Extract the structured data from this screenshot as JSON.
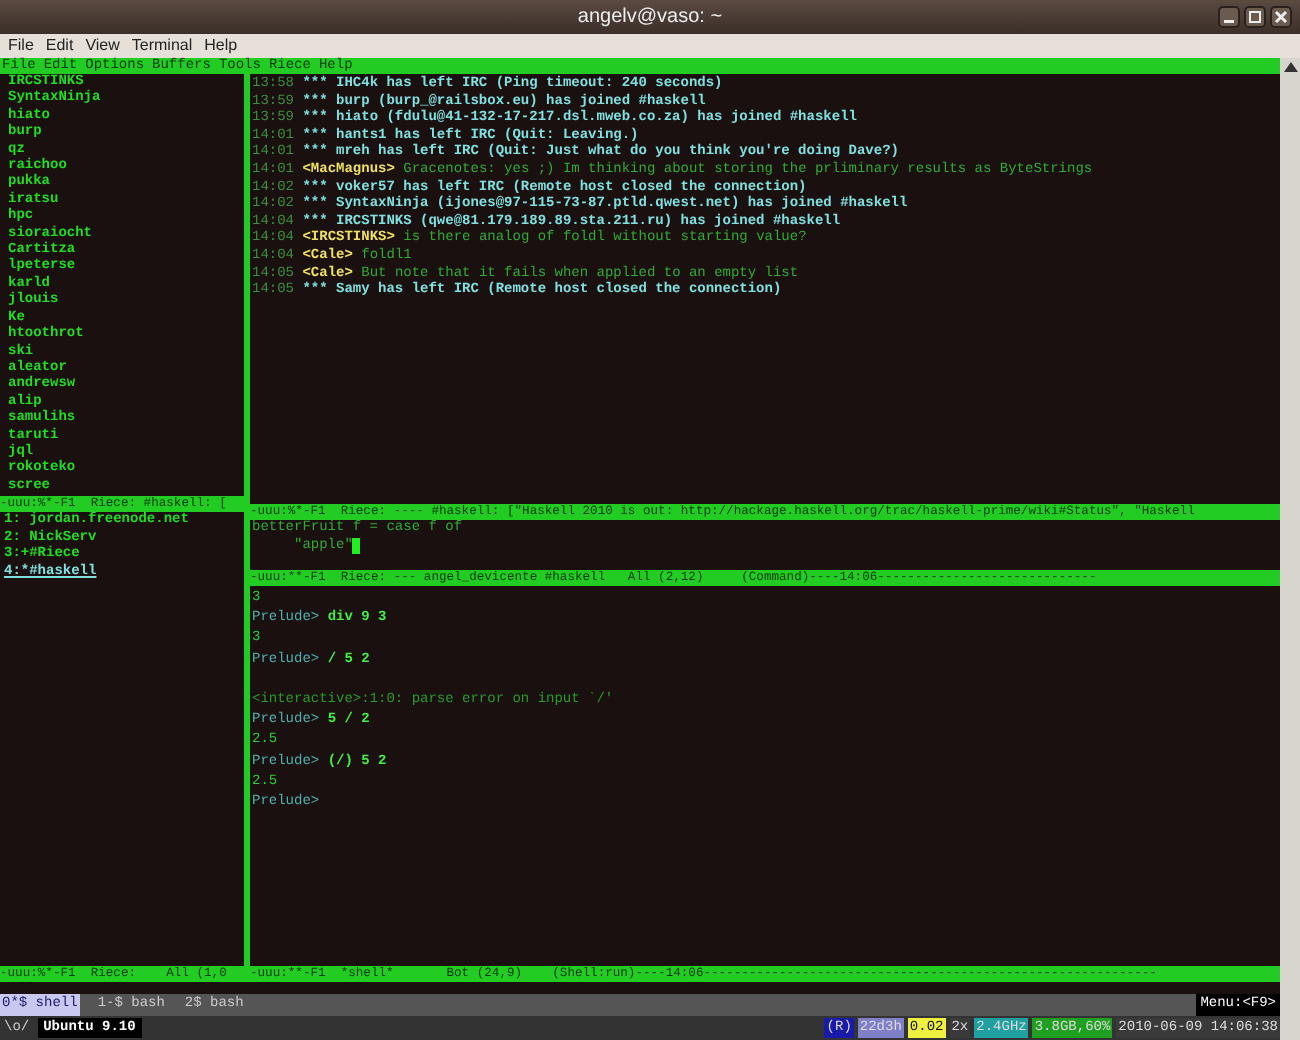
{
  "window": {
    "title": "angelv@vaso: ~"
  },
  "app_menu": [
    "File",
    "Edit",
    "View",
    "Terminal",
    "Help"
  ],
  "emacs_menu": [
    "File",
    "Edit",
    "Options",
    "Buffers",
    "Tools",
    "Riece",
    "Help"
  ],
  "nick_list": [
    "IRCSTINKS",
    "SyntaxNinja",
    "hiato",
    "burp",
    "qz",
    "raichoo",
    "pukka",
    "iratsu",
    "hpc",
    "sioraiocht",
    "Cartitza",
    "lpeterse",
    "karld",
    "jlouis",
    "Ke",
    "htoothrot",
    "ski",
    "aleator",
    "andrewsw",
    "alip",
    "samulihs",
    "taruti",
    "jql",
    "rokoteko",
    "scree"
  ],
  "chat": [
    {
      "time": "13:58",
      "kind": "notice",
      "marker": "***",
      "text": "IHC4k has left IRC (Ping timeout: 240 seconds)"
    },
    {
      "time": "13:59",
      "kind": "notice",
      "marker": "***",
      "text": "burp (burp_@railsbox.eu) has joined #haskell"
    },
    {
      "time": "13:59",
      "kind": "notice",
      "marker": "***",
      "text": "hiato (fdulu@41-132-17-217.dsl.mweb.co.za) has joined #haskell"
    },
    {
      "time": "14:01",
      "kind": "notice",
      "marker": "***",
      "text": "hants1 has left IRC (Quit: Leaving.)"
    },
    {
      "time": "14:01",
      "kind": "notice",
      "marker": "***",
      "text": "mreh has left IRC (Quit: Just what do you think you're doing Dave?)"
    },
    {
      "time": "14:01",
      "kind": "message",
      "nick": "<MacMagnus>",
      "text": "Gracenotes: yes ;) Im thinking about storing the prliminary results as ByteStrings"
    },
    {
      "time": "14:02",
      "kind": "notice",
      "marker": "***",
      "text": "voker57 has left IRC (Remote host closed the connection)"
    },
    {
      "time": "14:02",
      "kind": "notice",
      "marker": "***",
      "text": "SyntaxNinja (ijones@97-115-73-87.ptld.qwest.net) has joined #haskell"
    },
    {
      "time": "14:04",
      "kind": "notice",
      "marker": "***",
      "text": "IRCSTINKS (qwe@81.179.189.89.sta.211.ru) has joined #haskell"
    },
    {
      "time": "14:04",
      "kind": "message",
      "nick": "<IRCSTINKS>",
      "text": "is there analog of foldl without starting value?"
    },
    {
      "time": "14:04",
      "kind": "message",
      "nick": "<Cale>",
      "text": "foldl1"
    },
    {
      "time": "14:05",
      "kind": "message",
      "nick": "<Cale>",
      "text": "But note that it fails when applied to an empty list"
    },
    {
      "time": "14:05",
      "kind": "notice",
      "marker": "***",
      "text": "Samy has left IRC (Remote host closed the connection)"
    }
  ],
  "left_mode_line": "-uuu:%*-F1  Riece: #haskell: [",
  "buffers": [
    {
      "label": "1: jordan.freenode.net",
      "selected": false
    },
    {
      "label": "2: NickServ",
      "selected": false
    },
    {
      "label": "3:+#Riece",
      "selected": false
    },
    {
      "label": "4:*#haskell",
      "selected": true
    }
  ],
  "topic_mode_line": "-uuu:%*-F1  Riece: ---- #haskell: [\"Haskell 2010 is out: http://hackage.haskell.org/trac/haskell-prime/wiki#Status\", \"Haskell",
  "code": [
    "betterFruit f = case f of",
    "     \"apple\""
  ],
  "command_mode_line": "-uuu:**-F1  Riece: --- angel_devicente #haskell   All (2,12)     (Command)----14:06-----------------------------",
  "shell": [
    {
      "kind": "output",
      "text": "3"
    },
    {
      "kind": "prompt",
      "prompt": "Prelude>",
      "input": "div 9 3"
    },
    {
      "kind": "output",
      "text": "3"
    },
    {
      "kind": "prompt",
      "prompt": "Prelude>",
      "input": "/ 5 2"
    },
    {
      "kind": "blank"
    },
    {
      "kind": "error",
      "text": "<interactive>:1:0: parse error on input `/'"
    },
    {
      "kind": "prompt",
      "prompt": "Prelude>",
      "input": "5 / 2"
    },
    {
      "kind": "output",
      "text": "2.5"
    },
    {
      "kind": "prompt",
      "prompt": "Prelude>",
      "input": "(/) 5 2"
    },
    {
      "kind": "output",
      "text": "2.5"
    },
    {
      "kind": "prompt",
      "prompt": "Prelude>"
    }
  ],
  "bottom_left_mode_line": "-uuu:%*-F1  Riece:    All (1,0",
  "bottom_right_mode_line": "-uuu:**-F1  *shell*       Bot (24,9)    (Shell:run)----14:06------------------------------------------------------------",
  "byobu_tabs": [
    {
      "label": "0*$ shell",
      "selected": true
    },
    {
      "label": "1-$ bash",
      "selected": false
    },
    {
      "label": "2$ bash",
      "selected": false
    }
  ],
  "byobu_menu": "Menu:<F9>",
  "byobu_logo": "\\o/",
  "distro": "Ubuntu 9.10",
  "status_items": [
    {
      "text": "(R)",
      "color": "#1a1aa8"
    },
    {
      "text": "22d3h",
      "color": "#8080c8"
    },
    {
      "text": "0.02",
      "color": "#f0f040"
    },
    {
      "text": "2x",
      "color": "#3a3a3a"
    },
    {
      "text": "2.4GHz",
      "color": "#20a0a0"
    },
    {
      "text": "3.8GB,60%",
      "color": "#20a020"
    },
    {
      "text": "2010-06-09 14:06:38",
      "color": "#3a3a3a"
    }
  ]
}
